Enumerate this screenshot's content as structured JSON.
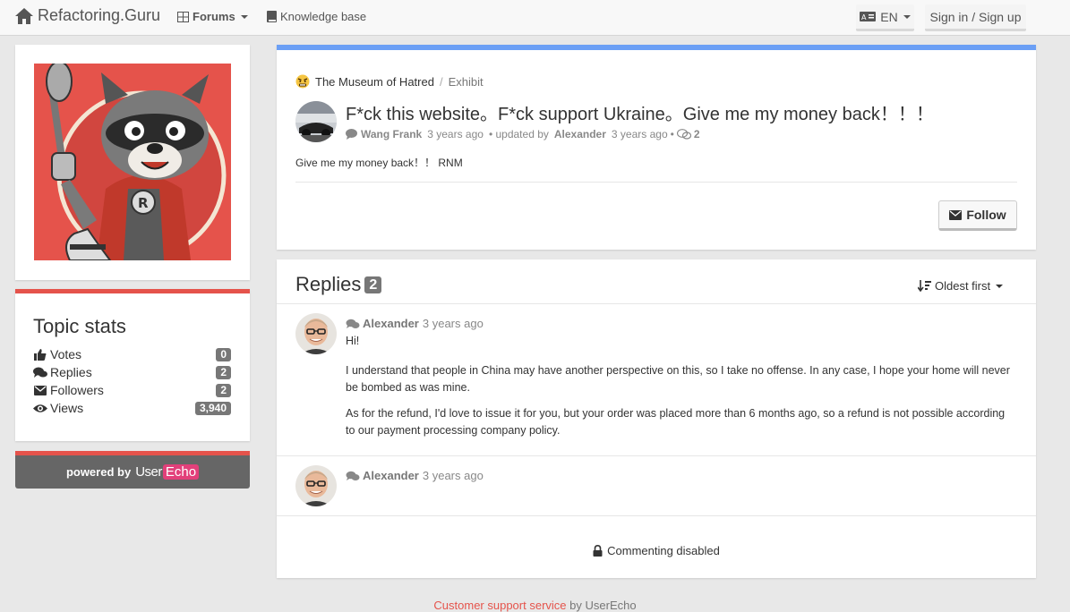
{
  "nav": {
    "brand": "Refactoring.Guru",
    "forums": "Forums",
    "knowledge_base": "Knowledge base",
    "lang": "EN",
    "sign_in": "Sign in / Sign up"
  },
  "stats": {
    "title": "Topic stats",
    "items": [
      {
        "label": "Votes",
        "value": "0"
      },
      {
        "label": "Replies",
        "value": "2"
      },
      {
        "label": "Followers",
        "value": "2"
      },
      {
        "label": "Views",
        "value": "3,940"
      }
    ]
  },
  "powered": {
    "prefix": "powered by",
    "brand_a": "User",
    "brand_b": "Echo"
  },
  "topic": {
    "forum": "The Museum of Hatred",
    "category": "Exhibit",
    "title": "F*ck this website。F*ck support Ukraine。Give me my money back！！！",
    "author": "Wang Frank",
    "created": "3 years ago",
    "updated_prefix": "• updated by",
    "updated_by": "Alexander",
    "updated": "3 years ago",
    "reply_count": "2",
    "body": "Give me my money back！！ RNM",
    "follow_label": "Follow"
  },
  "replies": {
    "title": "Replies",
    "count": "2",
    "sort": "Oldest first",
    "items": [
      {
        "author": "Alexander",
        "time": "3 years ago",
        "paragraphs": [
          "Hi!",
          "I understand that people in China may have another perspective on this, so I take no offense. In any case, I hope your home will never be bombed as was mine.",
          "As for the refund, I'd love to issue it for you, but your order was placed more than 6 months ago, so a refund is not possible according to our payment processing company policy."
        ]
      },
      {
        "author": "Alexander",
        "time": "3 years ago",
        "paragraphs": []
      }
    ],
    "commenting": "Commenting disabled"
  },
  "footer": {
    "link": "Customer support service",
    "suffix": "by UserEcho"
  },
  "colors": {
    "accent_red": "#e5534b",
    "topic_bar": "#6b9ff5",
    "badge": "#777777"
  }
}
